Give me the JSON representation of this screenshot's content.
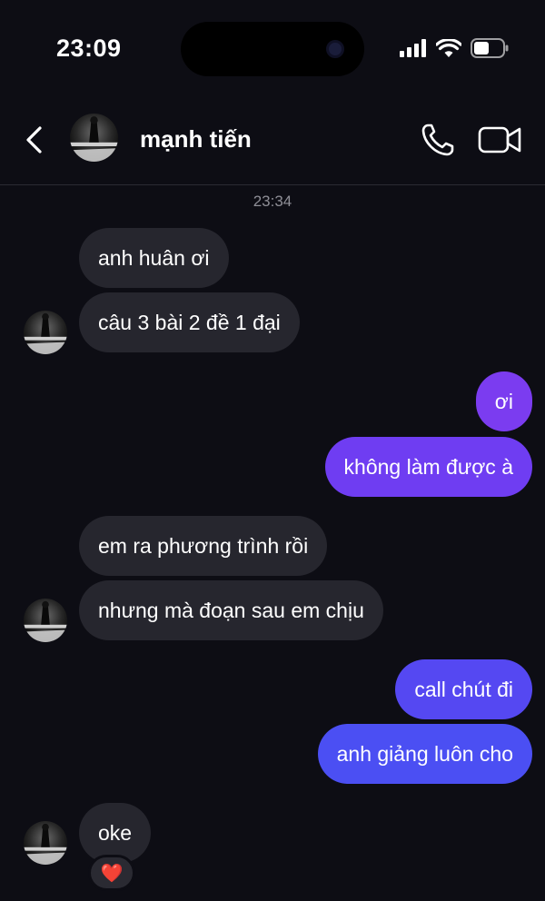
{
  "status": {
    "time": "23:09"
  },
  "header": {
    "contact_name": "mạnh tiến"
  },
  "timestamp": "23:34",
  "messages": [
    {
      "text": "anh huân ơi"
    },
    {
      "text": "câu 3 bài 2 đề 1 đại"
    },
    {
      "text": "ơi"
    },
    {
      "text": "không làm được à"
    },
    {
      "text": "em ra phương trình rồi"
    },
    {
      "text": "nhưng mà đoạn sau em chịu"
    },
    {
      "text": "call chút đi"
    },
    {
      "text": "anh giảng luôn cho"
    },
    {
      "text": "oke"
    }
  ],
  "reaction": "❤️",
  "colors": {
    "background": "#0d0d14",
    "incoming": "#26262e",
    "outgoing_purple": "#7b3cf0",
    "outgoing_blue": "#4b4ff3"
  },
  "icons": [
    "back-chevron-icon",
    "phone-icon",
    "video-camera-icon",
    "signal-icon",
    "wifi-icon",
    "battery-icon"
  ]
}
